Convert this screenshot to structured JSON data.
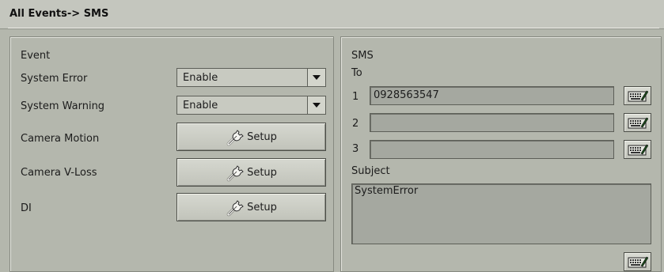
{
  "window": {
    "title": "All Events-> SMS"
  },
  "event_panel": {
    "heading": "Event",
    "rows": [
      {
        "label": "System Error",
        "value": "Enable"
      },
      {
        "label": "System Warning",
        "value": "Enable"
      },
      {
        "label": "Camera Motion",
        "button": "Setup"
      },
      {
        "label": "Camera V-Loss",
        "button": "Setup"
      },
      {
        "label": "DI",
        "button": "Setup"
      }
    ]
  },
  "sms_panel": {
    "heading": "SMS",
    "to_label": "To",
    "recipients": [
      {
        "index": "1",
        "value": "0928563547"
      },
      {
        "index": "2",
        "value": ""
      },
      {
        "index": "3",
        "value": ""
      }
    ],
    "subject_label": "Subject",
    "subject_value": "SystemError"
  },
  "icons": {
    "setup": "wrench-icon",
    "keyboard": "keyboard-pencil-icon",
    "dropdown": "chevron-down-icon"
  }
}
